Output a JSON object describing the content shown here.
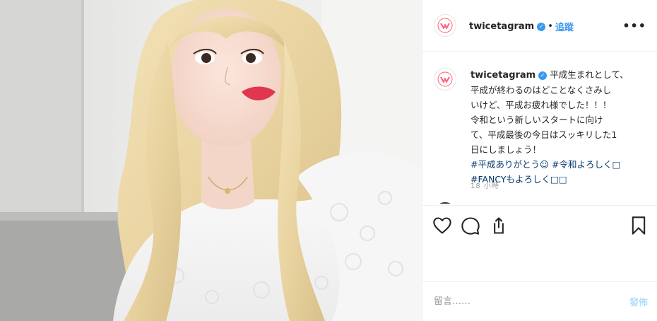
{
  "account": {
    "username": "twicetagram",
    "verified_mark": "✓",
    "separator": "•",
    "follow_label": "追蹤"
  },
  "header": {
    "more_label": "•••"
  },
  "caption": {
    "line1": "平成生まれとして、",
    "line2": "平成が終わるのはどことなくさみし",
    "line3": "いけど、平成お疲れ様でした！！！",
    "line4": "令和という新しいスタートに向け",
    "line5": "て、平成最後の今日はスッキリした1",
    "line6": "日にしましょう！",
    "hashtag1": "#平成ありがとう☺",
    "hashtag2": "#令和よろしく□",
    "hashtag3": "#FANCYもよろしく□□"
  },
  "timestamp": "18 小時",
  "actions": {
    "like_icon": "heart-icon",
    "comment_icon": "comment-icon",
    "share_icon": "share-icon",
    "save_icon": "bookmark-icon"
  },
  "comment_box": {
    "placeholder": "留言……",
    "post_label": "發佈"
  },
  "colors": {
    "accent": "#3897f0",
    "hashtag": "#003569",
    "brand": "#ff5f7a"
  }
}
